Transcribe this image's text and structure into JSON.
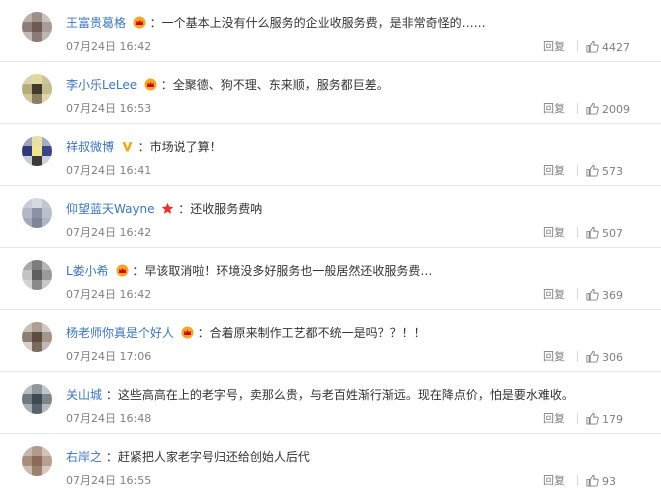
{
  "comments": [
    {
      "user": "王富贵葛格",
      "badge": "crown-icon",
      "text": "：一个基本上没有什么服务的企业收服务费，是非常奇怪的……",
      "time": "07月24日 16:42",
      "reply": "回复",
      "likes": "4427"
    },
    {
      "user": "李小乐LeLee",
      "badge": "crown-icon",
      "text": "：全聚德、狗不理、东来顺，服务都巨差。",
      "time": "07月24日 16:53",
      "reply": "回复",
      "likes": "2009"
    },
    {
      "user": "祥叔微博",
      "badge": "verified-v-icon",
      "text": "：市场说了算！",
      "time": "07月24日 16:41",
      "reply": "回复",
      "likes": "573"
    },
    {
      "user": "仰望蓝天Wayne",
      "badge": "star-icon",
      "text": "：还收服务费呐",
      "time": "07月24日 16:42",
      "reply": "回复",
      "likes": "507"
    },
    {
      "user": "L娄小希",
      "badge": "crown-icon",
      "text": "：早该取消啦！环境没多好服务也一般居然还收服务费…",
      "time": "07月24日 16:42",
      "reply": "回复",
      "likes": "369"
    },
    {
      "user": "杨老师你真是个好人",
      "badge": "crown-icon",
      "text": "：合着原来制作工艺都不统一是吗？？！！",
      "time": "07月24日 17:06",
      "reply": "回复",
      "likes": "306"
    },
    {
      "user": "关山城",
      "badge": "",
      "text": "：这些高高在上的老字号，卖那么贵，与老百姓渐行渐远。现在降点价，怕是要水难收。",
      "time": "07月24日 16:48",
      "reply": "回复",
      "likes": "179"
    },
    {
      "user": "右岸之",
      "badge": "",
      "text": "：赶紧把人家老字号归还给创始人后代",
      "time": "07月24日 16:55",
      "reply": "回复",
      "likes": "93"
    }
  ],
  "colors": {
    "username": "#3a75c4",
    "text": "#333333",
    "meta": "#808080",
    "crown": "#f5a623",
    "verified": "#f7a800",
    "star": "#e8342a"
  }
}
